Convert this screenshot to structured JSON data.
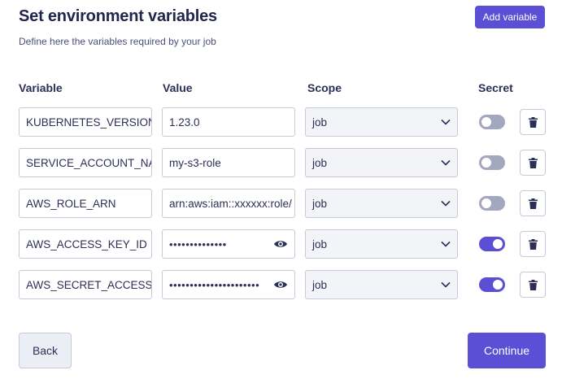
{
  "header": {
    "title": "Set environment variables",
    "subtitle": "Define here the variables required by your job",
    "add_label": "Add variable"
  },
  "columns": {
    "variable": "Variable",
    "value": "Value",
    "scope": "Scope",
    "secret": "Secret"
  },
  "rows": [
    {
      "name": "KUBERNETES_VERSION",
      "value": "1.23.0",
      "masked": false,
      "scope": "job",
      "secret": false
    },
    {
      "name": "SERVICE_ACCOUNT_NAME",
      "value": "my-s3-role",
      "masked": false,
      "scope": "job",
      "secret": false
    },
    {
      "name": "AWS_ROLE_ARN",
      "value": "arn:aws:iam::xxxxxx:role/",
      "masked": false,
      "scope": "job",
      "secret": false
    },
    {
      "name": "AWS_ACCESS_KEY_ID",
      "value": "••••••••••••••",
      "masked": true,
      "scope": "job",
      "secret": true
    },
    {
      "name": "AWS_SECRET_ACCESS_KEY",
      "value": "••••••••••••••••••••••",
      "masked": true,
      "scope": "job",
      "secret": true
    }
  ],
  "footer": {
    "back_label": "Back",
    "continue_label": "Continue"
  },
  "colors": {
    "accent": "#5b4fd6",
    "toggle_off": "#a3a7be",
    "text": "#2b2f55"
  },
  "icons": {
    "eye": "eye-icon",
    "chevron": "chevron-down-icon",
    "delete": "trash-icon"
  }
}
